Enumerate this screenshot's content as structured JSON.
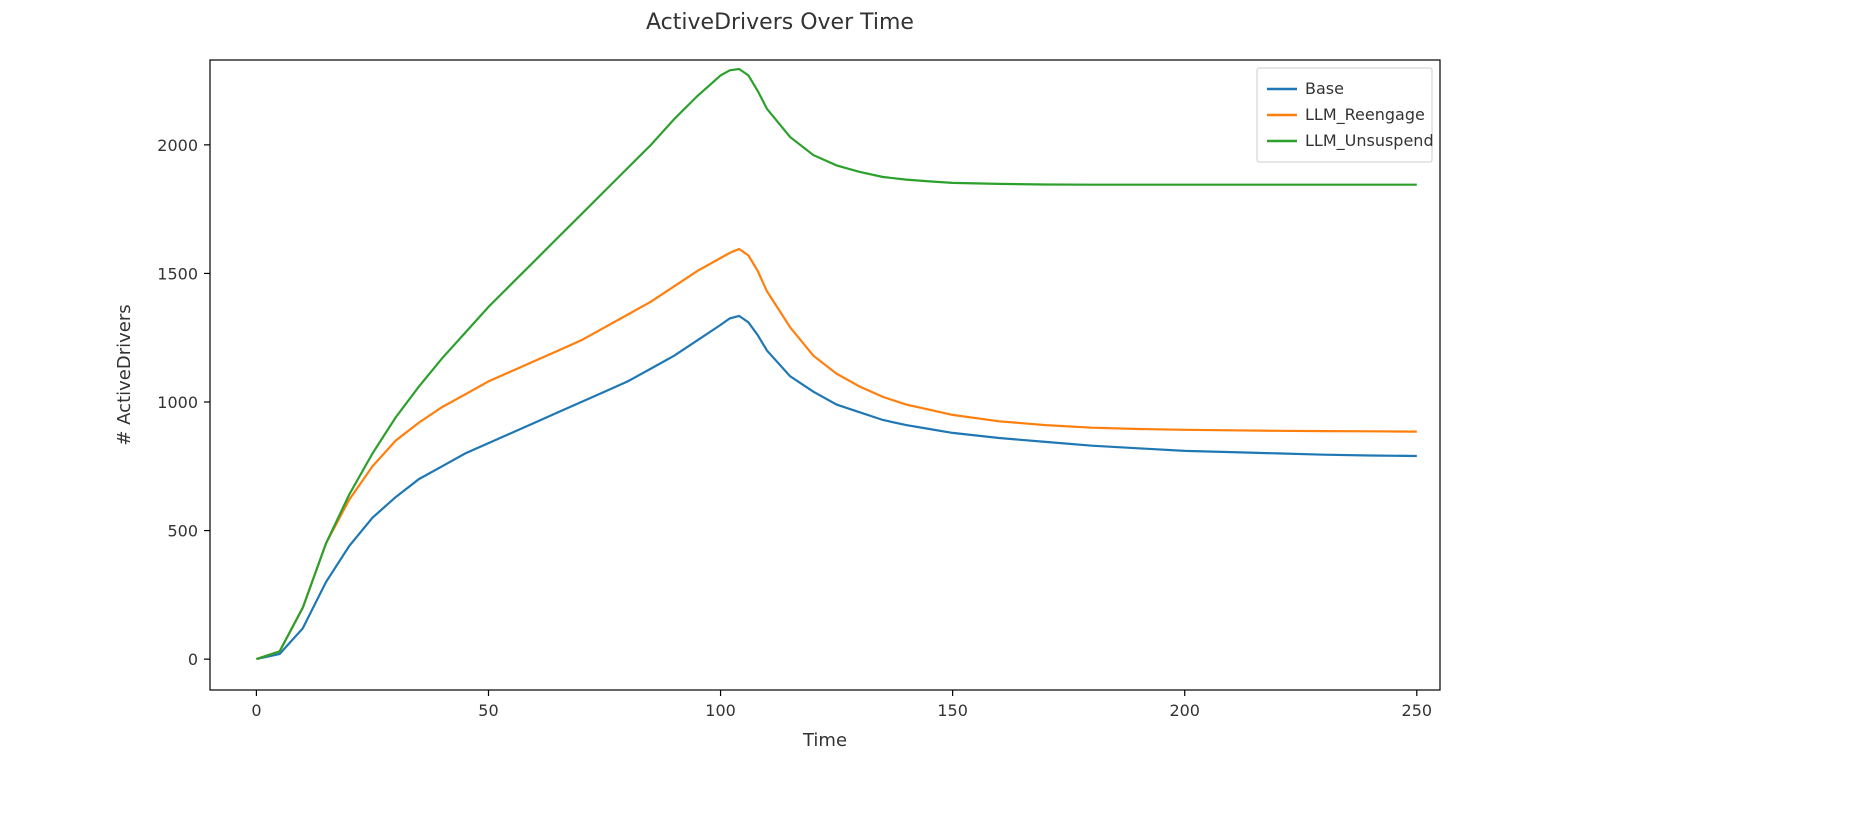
{
  "chart_data": {
    "type": "line",
    "title": "ActiveDrivers Over Time",
    "xlabel": "Time",
    "ylabel": "# ActiveDrivers",
    "xlim": [
      -10,
      255
    ],
    "ylim": [
      -120,
      2330
    ],
    "xticks": [
      0,
      50,
      100,
      150,
      200,
      250
    ],
    "yticks": [
      0,
      500,
      1000,
      1500,
      2000
    ],
    "legend_position": "upper right",
    "x": [
      0,
      5,
      10,
      15,
      20,
      25,
      30,
      35,
      40,
      45,
      50,
      55,
      60,
      65,
      70,
      75,
      80,
      85,
      90,
      95,
      100,
      102,
      104,
      106,
      108,
      110,
      115,
      120,
      125,
      130,
      135,
      140,
      145,
      150,
      160,
      170,
      180,
      190,
      200,
      210,
      220,
      230,
      240,
      250
    ],
    "series": [
      {
        "name": "Base",
        "color": "#1f77b4",
        "values": [
          0,
          20,
          120,
          300,
          440,
          550,
          630,
          700,
          750,
          800,
          840,
          880,
          920,
          960,
          1000,
          1040,
          1080,
          1130,
          1180,
          1240,
          1300,
          1325,
          1335,
          1310,
          1260,
          1200,
          1100,
          1040,
          990,
          960,
          930,
          910,
          895,
          880,
          860,
          845,
          830,
          820,
          810,
          805,
          800,
          795,
          792,
          790
        ]
      },
      {
        "name": "LLM_Reengage",
        "color": "#ff7f0e",
        "values": [
          0,
          30,
          200,
          450,
          620,
          750,
          850,
          920,
          980,
          1030,
          1080,
          1120,
          1160,
          1200,
          1240,
          1290,
          1340,
          1390,
          1450,
          1510,
          1560,
          1580,
          1595,
          1570,
          1510,
          1430,
          1290,
          1180,
          1110,
          1060,
          1020,
          990,
          970,
          950,
          925,
          910,
          900,
          895,
          892,
          890,
          888,
          887,
          886,
          885
        ]
      },
      {
        "name": "LLM_Unsuspend",
        "color": "#2ca02c",
        "values": [
          0,
          30,
          200,
          450,
          640,
          800,
          940,
          1060,
          1170,
          1270,
          1370,
          1460,
          1550,
          1640,
          1730,
          1820,
          1910,
          2000,
          2100,
          2190,
          2270,
          2290,
          2295,
          2270,
          2210,
          2140,
          2030,
          1960,
          1920,
          1895,
          1875,
          1865,
          1858,
          1852,
          1848,
          1846,
          1845,
          1845,
          1845,
          1845,
          1845,
          1845,
          1845,
          1845
        ]
      }
    ]
  }
}
